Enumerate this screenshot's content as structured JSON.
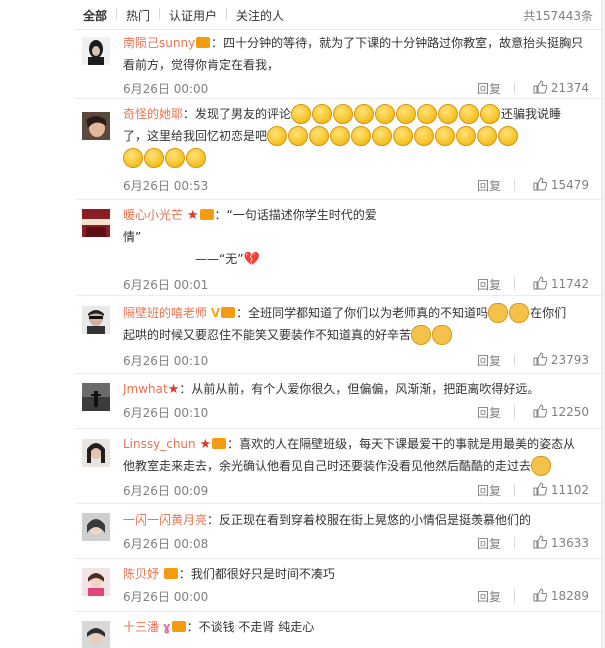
{
  "tabs": [
    {
      "label": "全部",
      "active": true
    },
    {
      "label": "热门",
      "active": false
    },
    {
      "label": "认证用户",
      "active": false
    },
    {
      "label": "关注的人",
      "active": false
    }
  ],
  "total": "共157443条",
  "reply_label": "回复",
  "comments": [
    {
      "user": "南陨己sunny",
      "lines": [
        "：四十分钟的等待，就为了下课的十分钟路过你教室，故意抬头挺胸只",
        "看前方，觉得你肯定在看我，"
      ],
      "time": "6月26日 00:00",
      "likes": "21374"
    },
    {
      "user": "奇怪的她耶",
      "lines": [
        "：发现了男友的评论",
        "还骗我说睡",
        "了，这里给我回忆初恋是吧"
      ],
      "time": "6月26日 00:53",
      "likes": "15479"
    },
    {
      "user": "暖心小光芒",
      "lines": [
        "：“一句话描述你学生时代的爱",
        "情”",
        "——“无”"
      ],
      "time": "6月26日 00:01",
      "likes": "11742"
    },
    {
      "user": "隔壁班的嘻老师",
      "lines": [
        "：全班同学都知道了你们以为老师真的不知道吗",
        "在你们",
        "起哄的时候又要忍住不能笑又要装作不知道真的好辛苦"
      ],
      "time": "6月26日 00:10",
      "likes": "23793"
    },
    {
      "user": "Jmwhat",
      "lines": [
        "：从前从前，有个人爱你很久，但偏偏，风渐渐，把距离吹得好远。"
      ],
      "time": "6月26日 00:10",
      "likes": "12250"
    },
    {
      "user": "Linssy_chun",
      "lines": [
        "：喜欢的人在隔壁班级，每天下课最爱干的事就是用最美的姿态从",
        "他教室走来走去，余光确认他看见自己时还要装作没看见他然后酷酷的走过去"
      ],
      "time": "6月26日 00:09",
      "likes": "11102"
    },
    {
      "user": "一闪一闪黄月亮",
      "lines": [
        "：反正现在看到穿着校服在街上晃悠的小情侣是挺羡慕他们的"
      ],
      "time": "6月26日 00:08",
      "likes": "13633"
    },
    {
      "user": "陈贝妤",
      "lines": [
        "：我们都很好只是时间不凑巧"
      ],
      "time": "6月26日 00:00",
      "likes": "18289"
    },
    {
      "user": "十三潘",
      "lines": [
        "：不谈钱 不走肾 纯走心"
      ],
      "time": "",
      "likes": ""
    }
  ],
  "colors": {
    "username": "#eb7350",
    "meta": "#808080",
    "text": "#333333"
  }
}
